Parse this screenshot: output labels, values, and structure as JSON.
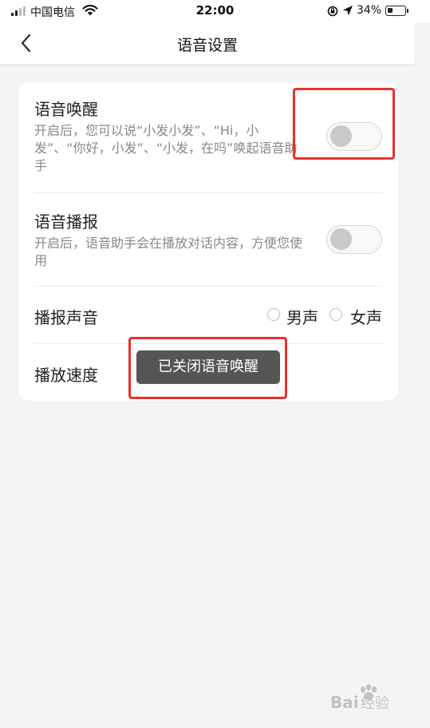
{
  "status_bar": {
    "carrier": "中国电信",
    "time": "22:00",
    "battery_percent": "34%",
    "battery_level": 0.34
  },
  "nav": {
    "title": "语音设置"
  },
  "settings": {
    "wake": {
      "title": "语音唤醒",
      "description": "开启后，您可以说“小发小发”、“Hi，小发”、“你好，小发”、“小发，在吗”唤起语音助手",
      "enabled": false
    },
    "broadcast": {
      "title": "语音播报",
      "description": "开启后，语音助手会在播放对话内容，方便您使用",
      "enabled": false
    },
    "voice": {
      "title": "播报声音",
      "options": [
        "男声",
        "女声"
      ]
    },
    "speed": {
      "title": "播放速度"
    }
  },
  "toast": {
    "message": "已关闭语音唤醒"
  },
  "colors": {
    "highlight": "#e8312c",
    "toast_bg": "#555555",
    "page_bg": "#f4f4f4"
  }
}
